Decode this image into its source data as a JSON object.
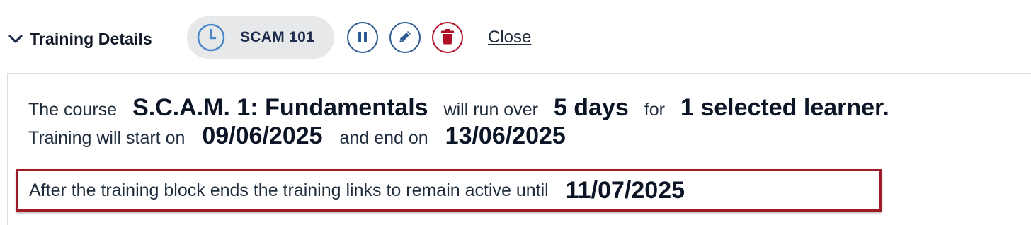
{
  "header": {
    "section_title": "Training Details",
    "toggle_icon": "chevron-down-icon",
    "course_code": "SCAM 101",
    "course_icon": "clock-icon",
    "actions": {
      "pause_icon": "pause-icon",
      "edit_icon": "pencil-icon",
      "delete_icon": "trash-icon"
    },
    "close_label": "Close"
  },
  "summary": {
    "prefix_course": "The course",
    "course_name": "S.C.A.M. 1: Fundamentals",
    "run_over": "will run over",
    "duration": "5 days",
    "for_word": "for",
    "learners": "1 selected learner.",
    "start_text": "Training will start on",
    "start_date": "09/06/2025",
    "end_text": "and end on",
    "end_date": "13/06/2025"
  },
  "links_notice": {
    "text": "After the training block ends the training links to remain active until",
    "date": "11/07/2025"
  },
  "colors": {
    "accent_blue": "#2d5b8f",
    "clock_blue": "#4a86c8",
    "danger_red": "#b01027",
    "highlight_border": "#9e1b2a",
    "pill_bg": "#e6e8ea"
  }
}
